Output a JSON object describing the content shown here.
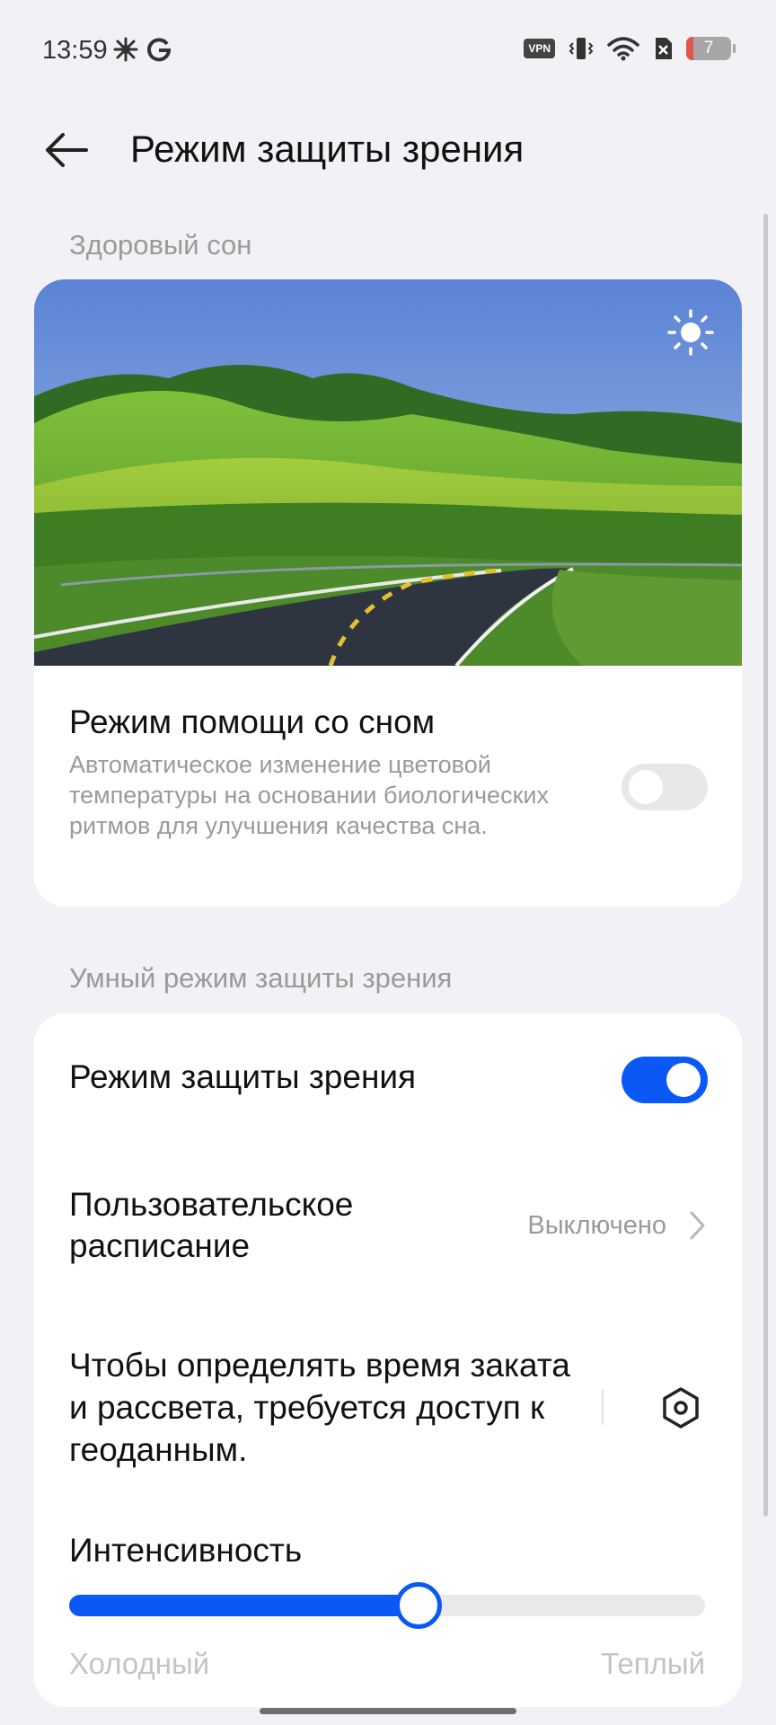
{
  "status": {
    "time": "13:59",
    "vpn": "VPN",
    "battery": "7"
  },
  "header": {
    "title": "Режим защиты зрения"
  },
  "sleep_section": {
    "title": "Здоровый сон",
    "row_title": "Режим помощи со сном",
    "row_desc": "Автоматическое изменение цветовой температуры на основании биологических ритмов для улучшения качества сна.",
    "toggle_on": false
  },
  "smart_section": {
    "title": "Умный режим защиты зрения",
    "eye_mode": {
      "label": "Режим защиты зрения",
      "on": true
    },
    "schedule": {
      "label": "Пользовательское расписание",
      "value": "Выключено"
    },
    "geo": {
      "label": "Чтобы определять время заката и рассвета, требуется доступ к геоданным."
    },
    "intensity": {
      "label": "Интенсивность",
      "value_percent": 55,
      "min_label": "Холодный",
      "max_label": "Теплый"
    }
  },
  "colors": {
    "accent": "#0a59f7",
    "background": "#f2f1f6"
  }
}
